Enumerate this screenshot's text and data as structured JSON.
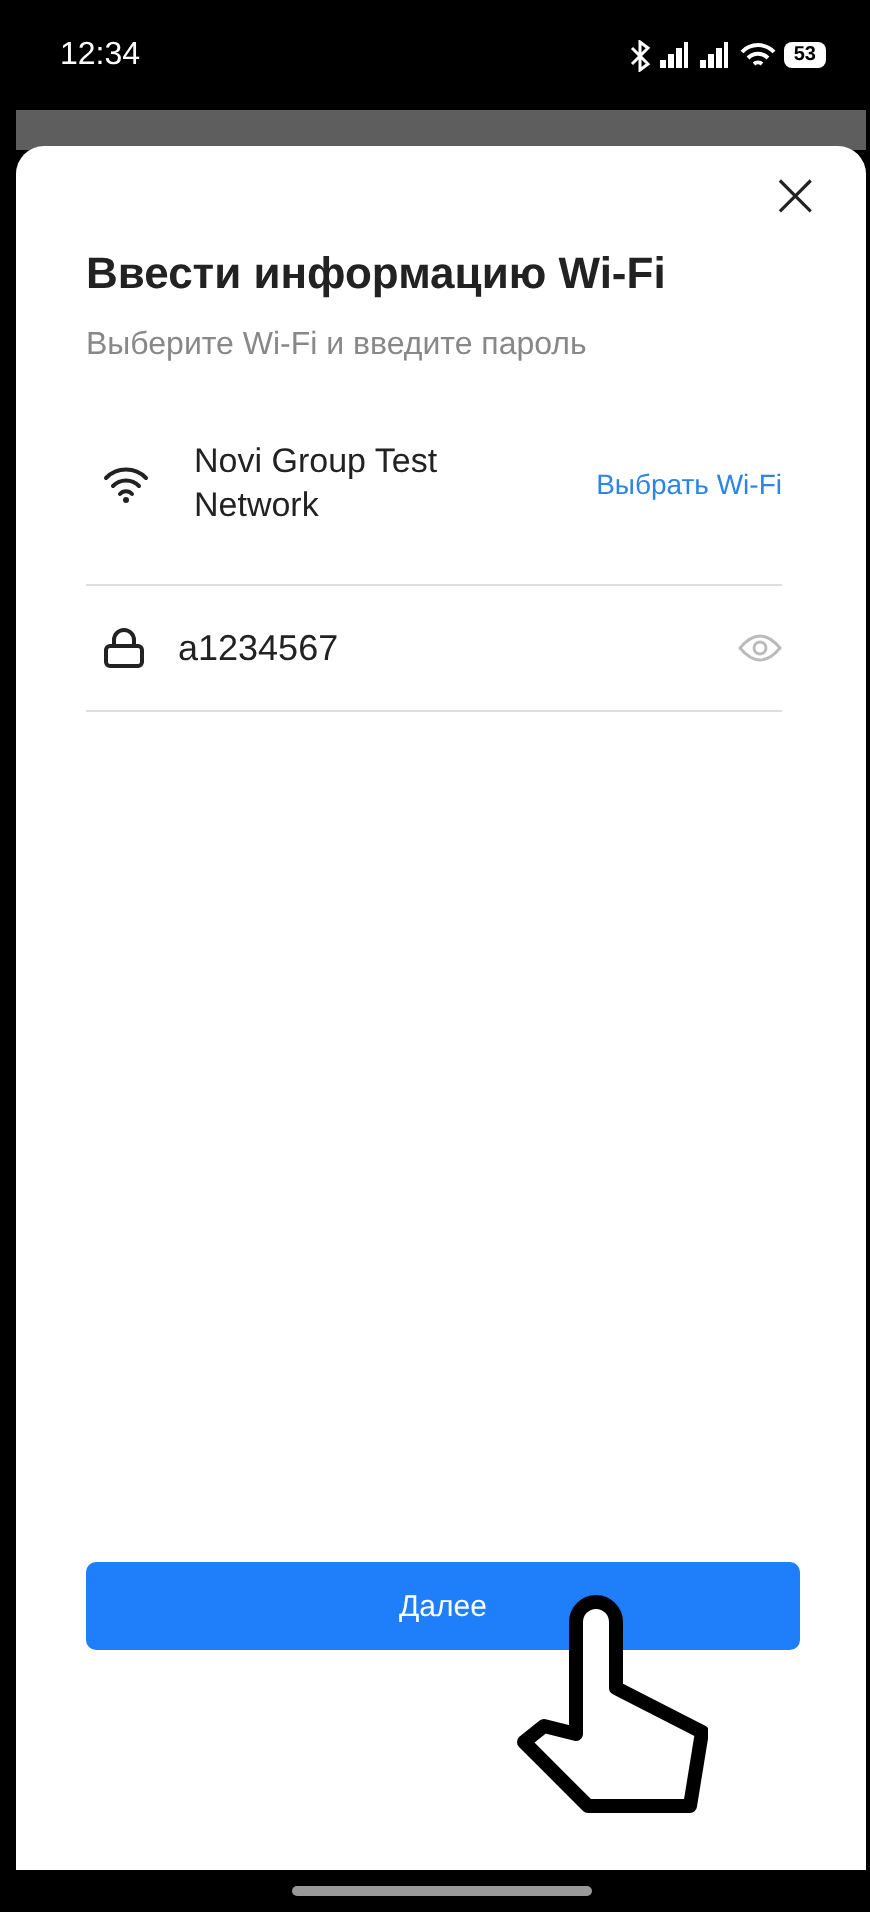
{
  "status_bar": {
    "time": "12:34",
    "battery": "53"
  },
  "dialog": {
    "close": "×",
    "title": "Ввести информацию Wi-Fi",
    "subtitle": "Выберите Wi-Fi и введите пароль",
    "network": {
      "name": "Novi Group Test Network",
      "action": "Выбрать Wi-Fi"
    },
    "password": {
      "value": "a1234567"
    },
    "next_button": "Далее"
  }
}
